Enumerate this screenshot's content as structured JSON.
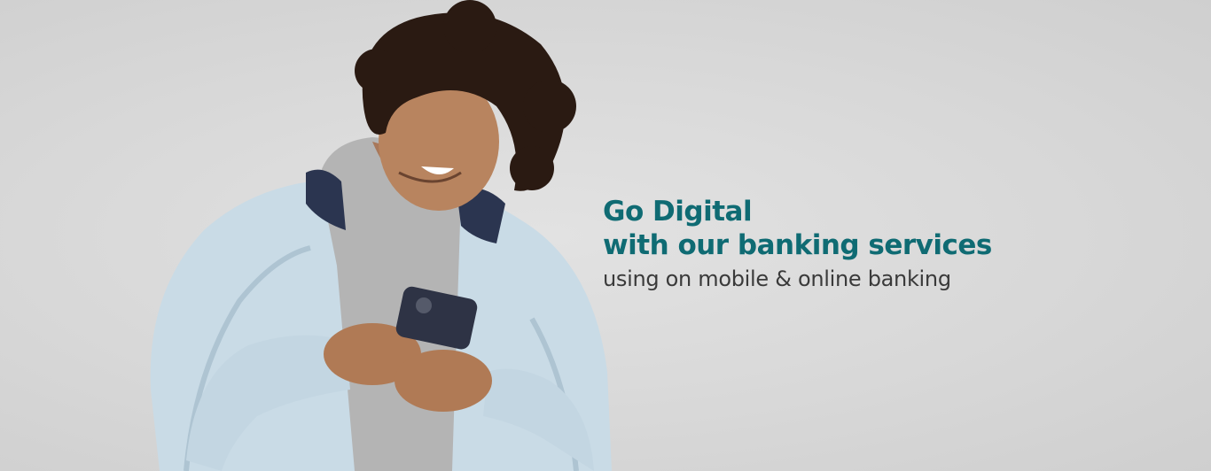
{
  "hero": {
    "headline_line1": "Go Digital",
    "headline_line2": "with our banking services",
    "subheadline": "using on mobile & online banking"
  },
  "colors": {
    "accent": "#0f6b73",
    "background": "#d9d9d9",
    "subtext": "#3a3a3a"
  }
}
